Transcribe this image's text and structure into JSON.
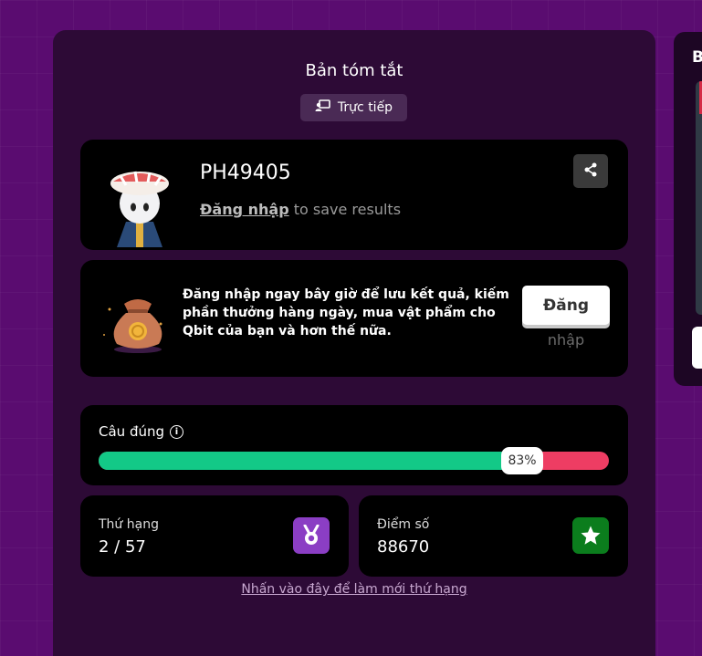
{
  "summary": {
    "title": "Bản tóm tắt",
    "live_label": "Trực tiếp"
  },
  "user": {
    "name": "PH49405",
    "login_link": "Đăng nhập",
    "login_suffix": " to save results"
  },
  "promo": {
    "text": "Đăng nhập ngay bây giờ để lưu kết quả, kiếm phần thưởng hàng ngày, mua vật phẩm cho Qbit của bạn và hơn thế nữa.",
    "button_label": "Đăng",
    "button_label_line2": "nhập"
  },
  "accuracy": {
    "label": "Câu đúng",
    "percent": 83,
    "percent_label": "83%"
  },
  "rank": {
    "label": "Thứ hạng",
    "value": "2 / 57"
  },
  "score": {
    "label": "Điểm số",
    "value": "88670"
  },
  "refresh_link": "Nhấn vào đây để làm mới thứ hạng",
  "side_panel": {
    "title_visible": "B"
  },
  "colors": {
    "correct": "#13c987",
    "incorrect": "#ee3d63",
    "rank_icon_bg": "#8b3ec4",
    "score_icon_bg": "#0b7d1d"
  },
  "icons": {
    "live": "presentation-icon",
    "share": "share-icon",
    "info": "info-icon",
    "rank": "medal-icon",
    "score": "star-icon"
  }
}
